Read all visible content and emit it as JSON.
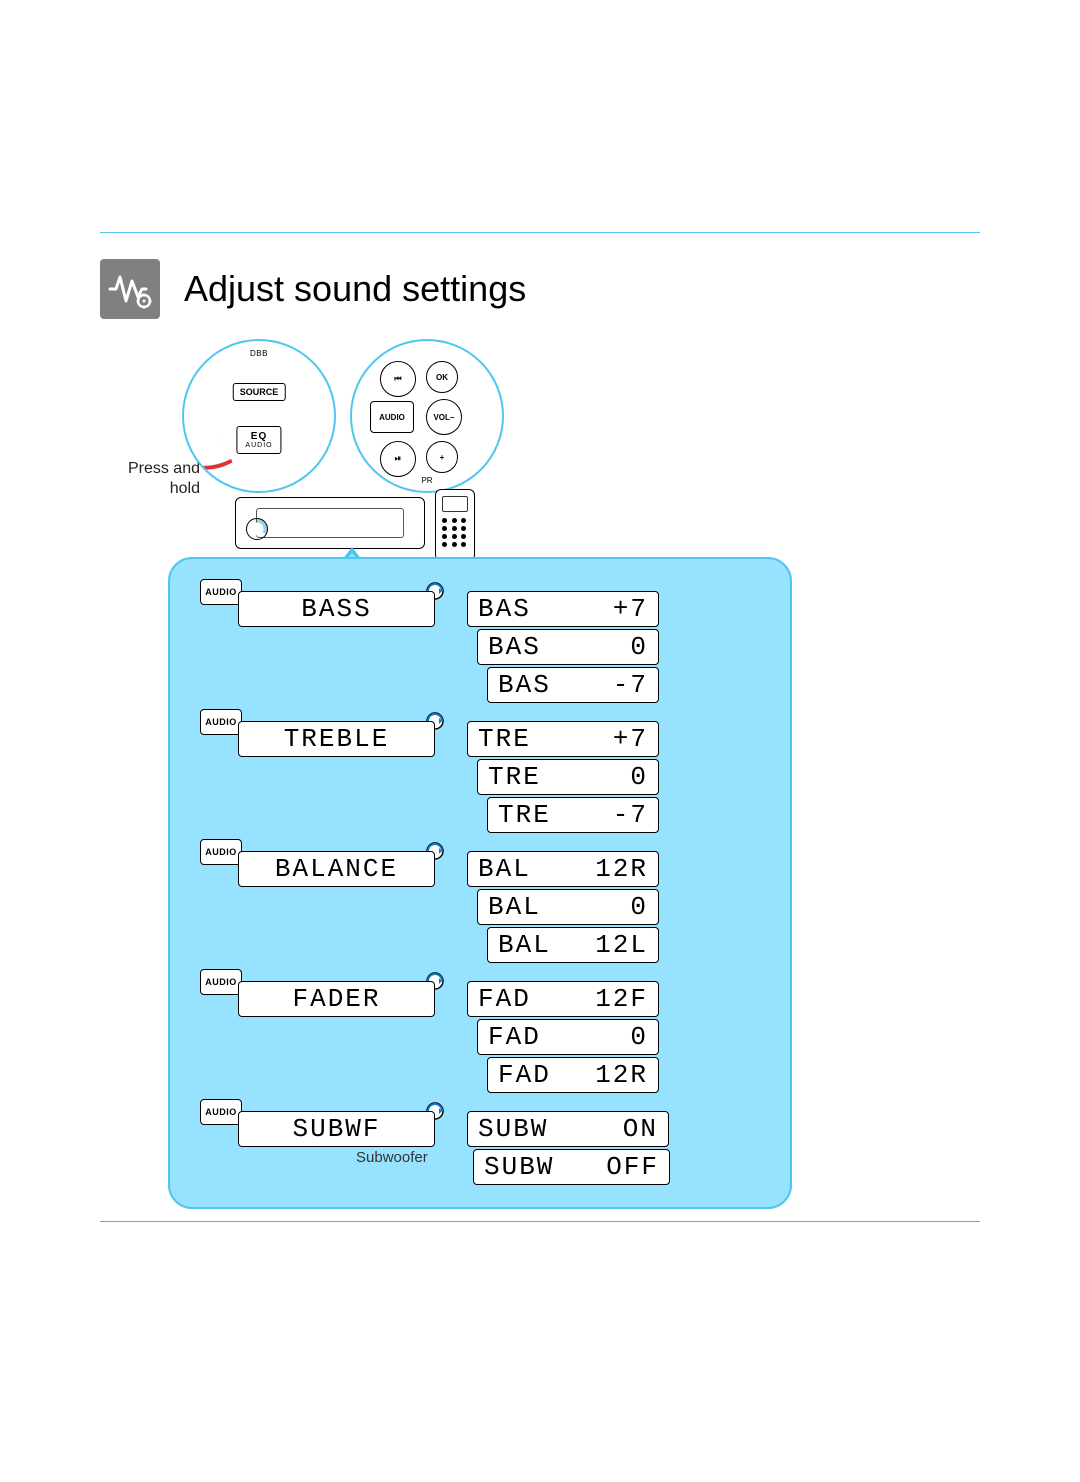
{
  "title": "Adjust sound settings",
  "instruction": "Press and hold",
  "bubble1": {
    "dbb": "DBB",
    "source": "SOURCE",
    "eq_main": "EQ",
    "eq_sub": "AUDIO"
  },
  "remote_btns": {
    "prev": "⏮",
    "ok": "OK",
    "audio": "AUDIO",
    "vol": "VOL−",
    "play": "⏯",
    "plus": "+",
    "pr": "PR"
  },
  "audio_label": "AUDIO",
  "subwoofer_caption": "Subwoofer",
  "settings": [
    {
      "name": "BASS",
      "values": [
        {
          "label": "BAS",
          "val": "+7"
        },
        {
          "label": "BAS",
          "val": "0"
        },
        {
          "label": "BAS",
          "val": "-7"
        }
      ]
    },
    {
      "name": "TREBLE",
      "values": [
        {
          "label": "TRE",
          "val": "+7"
        },
        {
          "label": "TRE",
          "val": "0"
        },
        {
          "label": "TRE",
          "val": "-7"
        }
      ]
    },
    {
      "name": "BALANCE",
      "values": [
        {
          "label": "BAL",
          "val": "12R"
        },
        {
          "label": "BAL",
          "val": "0"
        },
        {
          "label": "BAL",
          "val": "12L"
        }
      ]
    },
    {
      "name": "FADER",
      "values": [
        {
          "label": "FAD",
          "val": "12F"
        },
        {
          "label": "FAD",
          "val": "0"
        },
        {
          "label": "FAD",
          "val": "12R"
        }
      ]
    },
    {
      "name": "SUBWF",
      "values": [
        {
          "label": "SUBW",
          "val": "ON"
        },
        {
          "label": "SUBW",
          "val": "OFF"
        }
      ]
    }
  ]
}
